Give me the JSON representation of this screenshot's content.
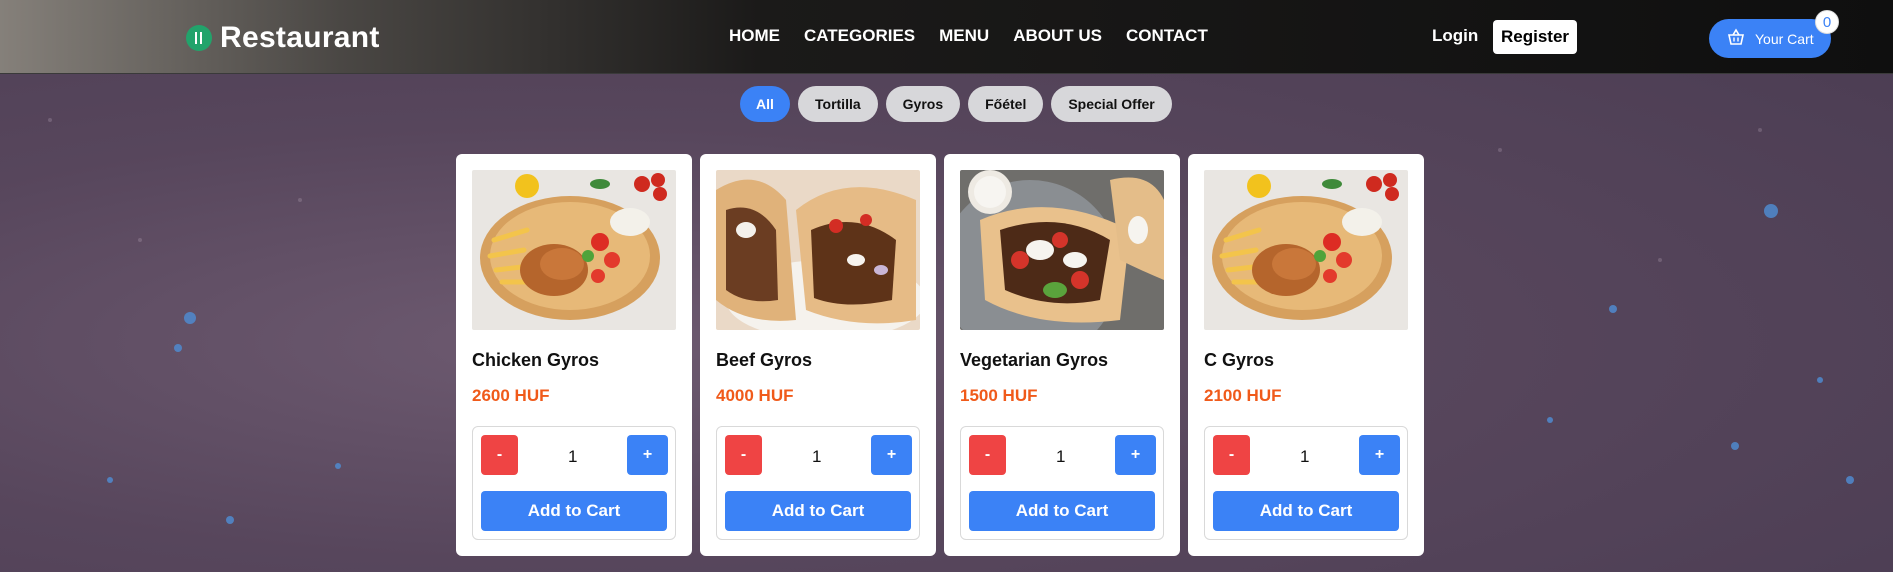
{
  "brand": {
    "name": "Restaurant",
    "logo_icon": "fork-knife-icon",
    "logo_color": "#22a36b"
  },
  "nav": {
    "links": [
      "HOME",
      "CATEGORIES",
      "MENU",
      "ABOUT US",
      "CONTACT"
    ],
    "login": "Login",
    "register": "Register",
    "cart_label": "Your Cart",
    "cart_count": "0",
    "cart_icon": "basket-icon"
  },
  "filters": [
    "All",
    "Tortilla",
    "Gyros",
    "Főétel",
    "Special Offer"
  ],
  "active_filter": "All",
  "colors": {
    "accent": "#3b82f6",
    "danger": "#ef4444",
    "price": "#f05a1a"
  },
  "products": [
    {
      "name": "Chicken Gyros",
      "price": "2600 HUF",
      "qty": "1",
      "minus": "-",
      "plus": "+",
      "add": "Add to Cart",
      "image_icon": "gyros-plate-image"
    },
    {
      "name": "Beef Gyros",
      "price": "4000 HUF",
      "qty": "1",
      "minus": "-",
      "plus": "+",
      "add": "Add to Cart",
      "image_icon": "beef-wrap-image"
    },
    {
      "name": "Vegetarian Gyros",
      "price": "1500 HUF",
      "qty": "1",
      "minus": "-",
      "plus": "+",
      "add": "Add to Cart",
      "image_icon": "veg-wrap-image"
    },
    {
      "name": "C Gyros",
      "price": "2100 HUF",
      "qty": "1",
      "minus": "-",
      "plus": "+",
      "add": "Add to Cart",
      "image_icon": "gyros-plate-image"
    }
  ]
}
